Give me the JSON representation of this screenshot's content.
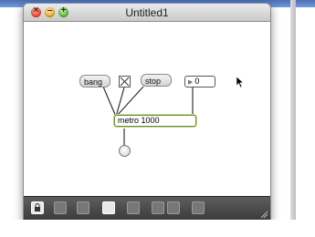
{
  "window": {
    "title": "Untitled1"
  },
  "patch": {
    "bang_label": "bang",
    "stop_label": "stop",
    "number_value": "0",
    "metro_label": "metro 1000"
  },
  "colors": {
    "close": "#d92a1c",
    "minimize": "#d8a114",
    "maximize": "#3fa125",
    "toolbar": "#3a3a3a"
  },
  "toolbar": {
    "icons": [
      "lock-icon",
      "add-object-icon",
      "move-icon",
      "presentation-icon",
      "inspector-icon",
      "grid-icon",
      "window-icon",
      "layout-icon"
    ]
  }
}
